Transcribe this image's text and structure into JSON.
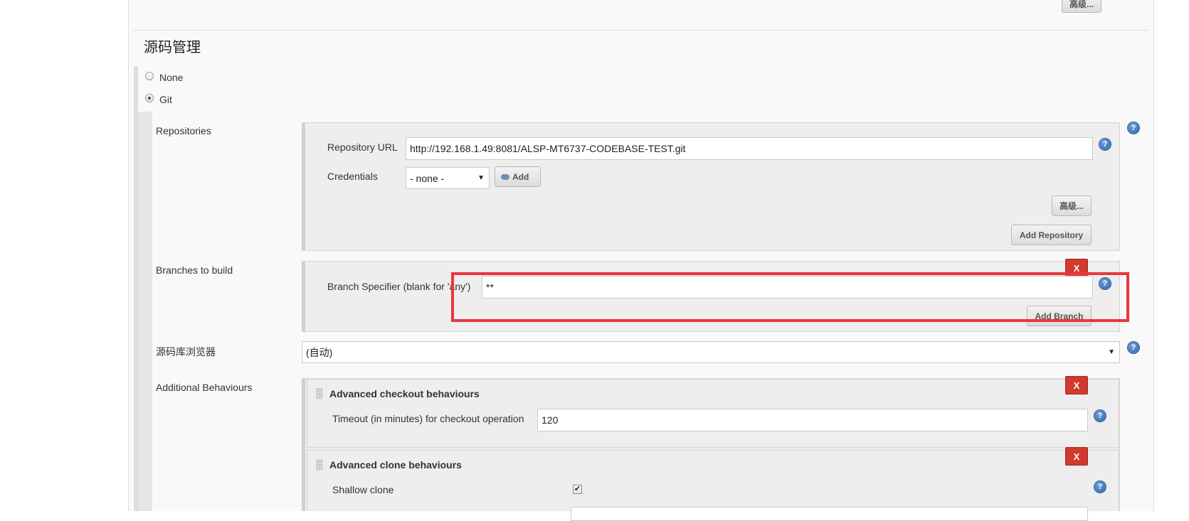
{
  "top": {
    "advanced_label": "高级..."
  },
  "section": {
    "title": "源码管理"
  },
  "scm": {
    "none_label": "None",
    "git_label": "Git",
    "selected": "Git"
  },
  "repositories": {
    "label": "Repositories",
    "url_label": "Repository URL",
    "url_value": "http://192.168.1.49:8081/ALSP-MT6737-CODEBASE-TEST.git",
    "credentials_label": "Credentials",
    "credentials_value": "- none -",
    "add_label": "Add",
    "advanced_label": "高级...",
    "add_repository_label": "Add Repository"
  },
  "branches": {
    "label": "Branches to build",
    "specifier_label": "Branch Specifier (blank for 'any')",
    "specifier_value": "**",
    "remove_label": "X",
    "add_branch_label": "Add Branch"
  },
  "browser": {
    "label": "源码库浏览器",
    "value": "(自动)"
  },
  "behaviours": {
    "label": "Additional Behaviours",
    "checkout": {
      "title": "Advanced checkout behaviours",
      "timeout_label": "Timeout (in minutes) for checkout operation",
      "timeout_value": "120",
      "remove_label": "X"
    },
    "clone": {
      "title": "Advanced clone behaviours",
      "shallow_label": "Shallow clone",
      "shallow_checked": true,
      "remove_label": "X"
    }
  },
  "colors": {
    "highlight": "#e8363d",
    "remove_button": "#d13a2f",
    "help_icon": "#2f64a8"
  },
  "icons": {
    "help": "help-question-icon",
    "key": "key-icon",
    "drag": "drag-handle-icon",
    "dropdown": "chevron-down-icon"
  }
}
